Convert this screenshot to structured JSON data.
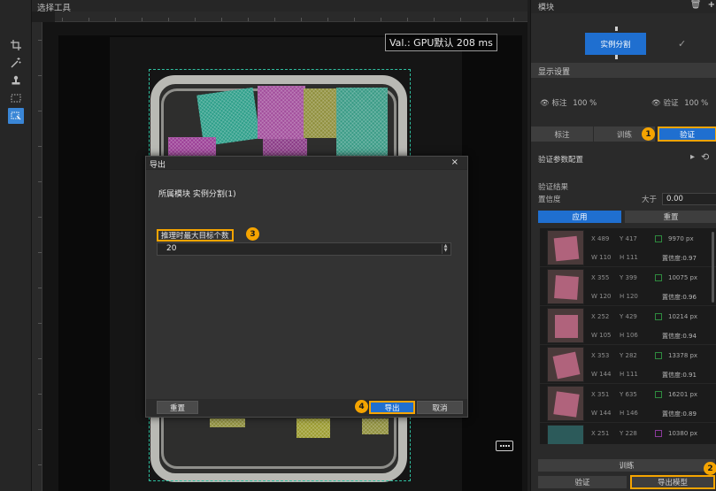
{
  "canvas": {
    "title": "选择工具",
    "value_badge": "Val.: GPU默认 208 ms"
  },
  "tools": [
    "crop-tool-icon",
    "magic-wand-icon",
    "stamp-icon",
    "marquee-select-icon",
    "select-tool-icon"
  ],
  "dialog": {
    "title": "导出",
    "close": "×",
    "module_line": "所属模块 实例分割(1)",
    "param_label": "推理时最大目标个数",
    "param_value": "20",
    "reset_label": "重置",
    "export_label": "导出",
    "cancel_label": "取消"
  },
  "steps": {
    "s1": "1",
    "s2": "2",
    "s3": "3",
    "s4": "4"
  },
  "right_panel": {
    "title": "模块",
    "module_node_label": "实例分割",
    "display_settings": "显示设置",
    "label_toggle": "标注",
    "label_opacity": "100 %",
    "validate_toggle": "验证",
    "validate_opacity": "100 %",
    "tabs": [
      "标注",
      "训练",
      "验证"
    ],
    "validate_params": "验证参数配置",
    "validate_results": "验证结果",
    "confidence_label": "置信度",
    "confidence_op": "大于",
    "confidence_value": "0.00",
    "apply_label": "应用",
    "reset_label": "重置",
    "train_label": "训练",
    "validate_label": "验证",
    "export_model_label": "导出模型"
  },
  "results": [
    {
      "x": "X 489",
      "y": "Y 417",
      "w": "W 110",
      "h": "H 111",
      "px": "9970 px",
      "conf": "置信度:0.97"
    },
    {
      "x": "X 355",
      "y": "Y 399",
      "w": "W 120",
      "h": "H 120",
      "px": "10075 px",
      "conf": "置信度:0.96"
    },
    {
      "x": "X 252",
      "y": "Y 429",
      "w": "W 105",
      "h": "H 106",
      "px": "10214 px",
      "conf": "置信度:0.94"
    },
    {
      "x": "X 353",
      "y": "Y 282",
      "w": "W 144",
      "h": "H 111",
      "px": "13378 px",
      "conf": "置信度:0.91"
    },
    {
      "x": "X 351",
      "y": "Y 635",
      "w": "W 144",
      "h": "H 146",
      "px": "16201 px",
      "conf": "置信度:0.89"
    },
    {
      "x": "X 251",
      "y": "Y 228",
      "w": "",
      "h": "",
      "px": "10380 px",
      "conf": ""
    }
  ],
  "colors": {
    "accent_blue": "#1f6fd0",
    "highlight_orange": "#f5a400",
    "cube_magenta": "#b0637c"
  }
}
